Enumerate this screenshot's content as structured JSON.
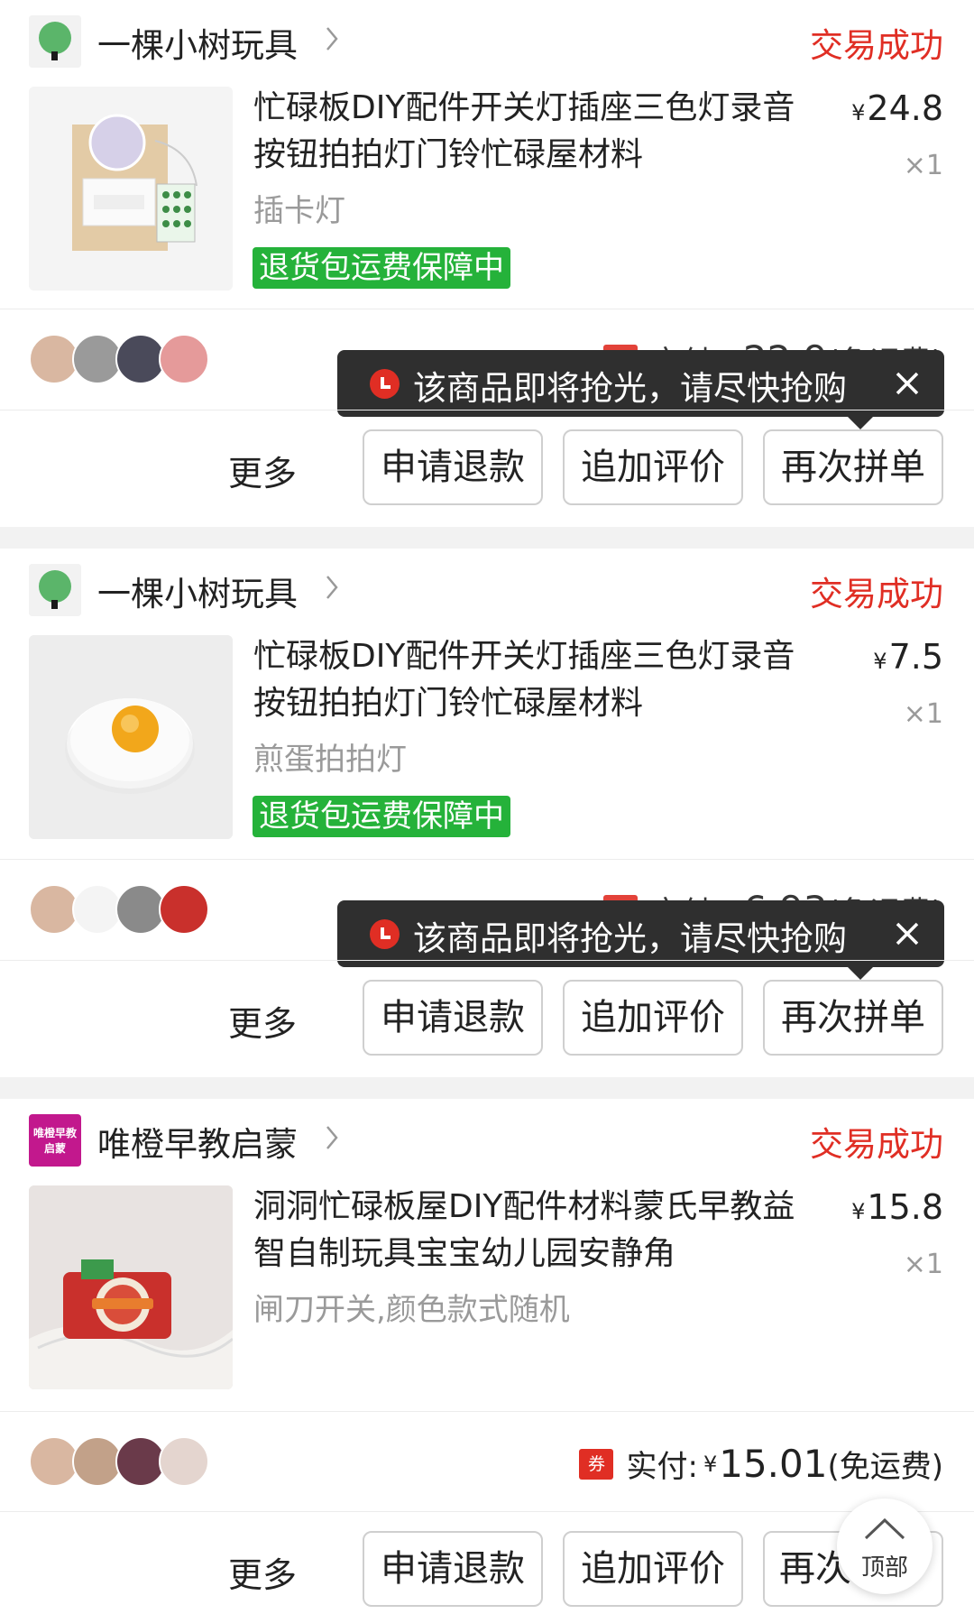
{
  "orders": [
    {
      "shop_name": "一棵小树玩具",
      "shop_logo": "tree-logo",
      "status": "交易成功",
      "title": "忙碌板DIY配件开关灯插座三色灯录音按钮拍拍灯门铃忙碌屋材料",
      "price_symbol": "¥",
      "price": "24.8",
      "qty": "×1",
      "spec": "插卡灯",
      "guarantee": "退货包运费保障中",
      "pay_label": "实付:",
      "pay_amount": "22.9",
      "pay_note": "(免运费)",
      "coupon": "券",
      "tooltip": "该商品即将抢光，请尽快抢购",
      "more": "更多",
      "buttons": [
        "申请退款",
        "追加评价",
        "再次拼单"
      ]
    },
    {
      "shop_name": "一棵小树玩具",
      "shop_logo": "tree-logo",
      "status": "交易成功",
      "title": "忙碌板DIY配件开关灯插座三色灯录音按钮拍拍灯门铃忙碌屋材料",
      "price_symbol": "¥",
      "price": "7.5",
      "qty": "×1",
      "spec": "煎蛋拍拍灯",
      "guarantee": "退货包运费保障中",
      "pay_label": "实付:",
      "pay_amount": "6.93",
      "pay_note": "(免运费)",
      "coupon": "券",
      "tooltip": "该商品即将抢光，请尽快抢购",
      "more": "更多",
      "buttons": [
        "申请退款",
        "追加评价",
        "再次拼单"
      ]
    },
    {
      "shop_name": "唯橙早教启蒙",
      "shop_logo_text": "唯橙早教启蒙",
      "status": "交易成功",
      "title": "洞洞忙碌板屋DIY配件材料蒙氏早教益智自制玩具宝宝幼儿园安静角",
      "price_symbol": "¥",
      "price": "15.8",
      "qty": "×1",
      "spec": "闸刀开关,颜色款式随机",
      "pay_label": "实付:",
      "pay_amount": "15.01",
      "pay_note": "(免运费)",
      "coupon": "券",
      "more": "更多",
      "buttons": [
        "申请退款",
        "追加评价",
        "再次"
      ]
    }
  ],
  "top_button": {
    "label": "顶部",
    "icon": "chevron-up-icon"
  },
  "colors": {
    "accent_red": "#e02e24",
    "guarantee_green": "#25b23a",
    "tooltip_bg": "#2f2f2f"
  }
}
